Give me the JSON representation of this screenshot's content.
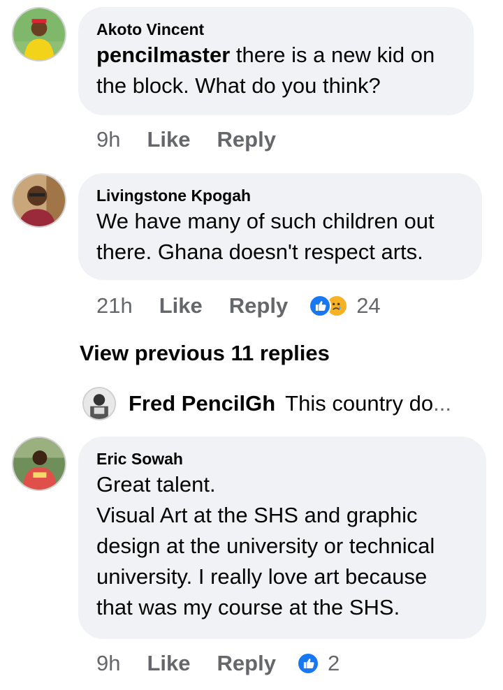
{
  "comments": [
    {
      "author": "Akoto Vincent",
      "mention": "pencilmaster",
      "lines": [
        "there is a new kid on",
        "the block. What do you think?"
      ],
      "time": "9h",
      "like_label": "Like",
      "reply_label": "Reply"
    },
    {
      "author": "Livingstone Kpogah",
      "lines": [
        "We have many of such children out",
        "there. Ghana doesn't respect arts."
      ],
      "time": "21h",
      "like_label": "Like",
      "reply_label": "Reply",
      "reaction_count": "24",
      "reactions": [
        "like-icon",
        "sad-icon"
      ]
    },
    {
      "author": "Eric Sowah",
      "lines": [
        "Great talent.",
        "Visual Art at the SHS and graphic",
        "design at the university or technical",
        "university. I really love art because",
        "that was my course at the SHS."
      ],
      "time": "9h",
      "like_label": "Like",
      "reply_label": "Reply",
      "reaction_count": "2",
      "reactions": [
        "like-icon"
      ]
    }
  ],
  "view_previous": "View previous 11 replies",
  "reply_preview": {
    "author": "Fred PencilGh",
    "text": "This country do",
    "ellipsis": "..."
  },
  "colors": {
    "bubble": "#f0f2f5",
    "meta_text": "#65676b",
    "like_blue": "#1877f2",
    "sad_yellow": "#f7b125"
  }
}
